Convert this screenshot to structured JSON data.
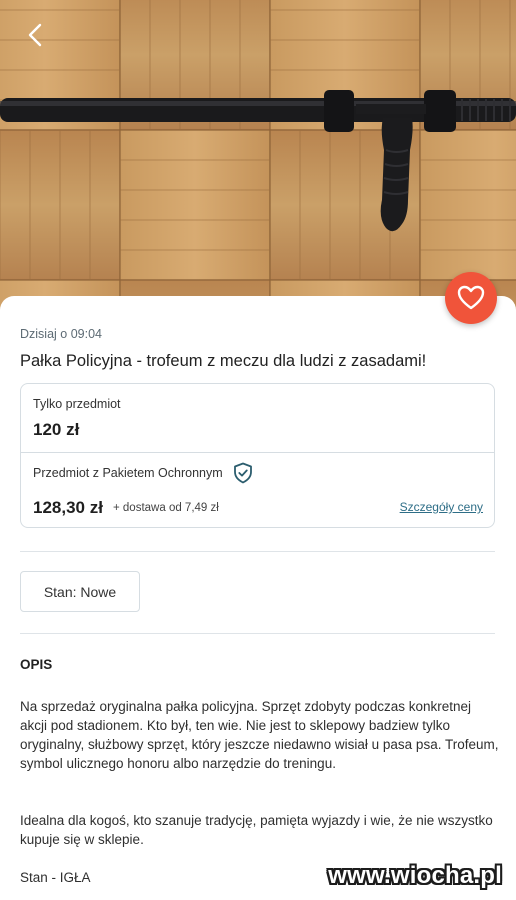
{
  "listing": {
    "posted": "Dzisiaj o 09:04",
    "title": "Pałka Policyjna - trofeum z meczu dla ludzi z zasadami!"
  },
  "pricing": {
    "item_only_label": "Tylko przedmiot",
    "item_only_price": "120 zł",
    "protected_label": "Przedmiot z Pakietem Ochronnym",
    "protected_price": "128,30 zł",
    "shipping_note": "+ dostawa od 7,49 zł",
    "details_link": "Szczegóły ceny"
  },
  "condition_chip": "Stan: Nowe",
  "description": {
    "heading": "OPIS",
    "paragraph_1": "Na sprzedaż oryginalna pałka policyjna. Sprzęt zdobyty podczas konkretnej akcji pod stadionem. Kto był, ten wie. Nie jest to sklepowy badziew tylko oryginalny, służbowy sprzęt, który jeszcze niedawno wisiał u pasa psa. Trofeum, symbol ulicznego honoru albo narzędzie do treningu.",
    "paragraph_2": "Idealna dla kogoś, kto szanuje tradycję, pamięta wyjazdy i wie, że nie wszystko kupuje się w sklepie.",
    "condition_line": "Stan - IGŁA"
  },
  "watermark": "www.wiocha.pl",
  "icons": {
    "back": "chevron-left-icon",
    "favorite": "heart-icon",
    "protection": "shield-check-icon"
  },
  "colors": {
    "favorite_button": "#f0543a",
    "link": "#2e6e87"
  }
}
